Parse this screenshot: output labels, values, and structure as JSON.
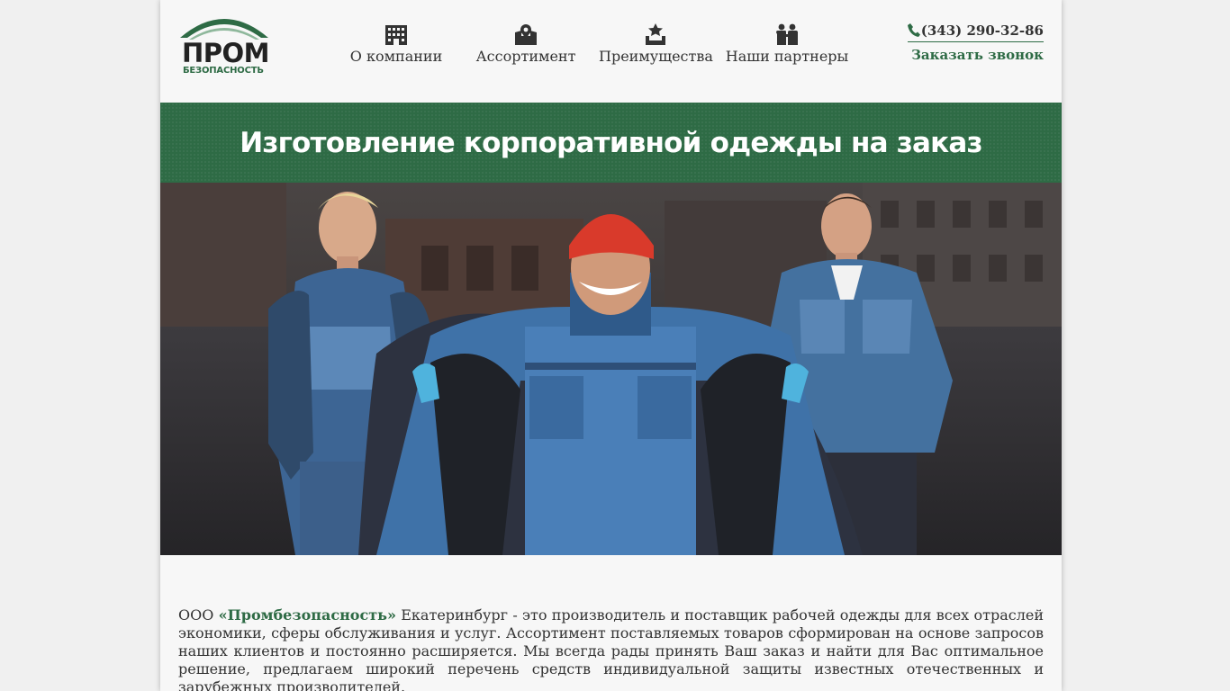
{
  "logo": {
    "word": "ПРОМ",
    "sub": "БЕЗОПАСНОСТЬ"
  },
  "nav": [
    {
      "label": "О компании",
      "icon": "building-icon"
    },
    {
      "label": "Ассортимент",
      "icon": "map-pin-icon"
    },
    {
      "label": "Преимущества",
      "icon": "award-icon"
    },
    {
      "label": "Наши партнеры",
      "icon": "partners-icon"
    }
  ],
  "contact": {
    "phone": "(343) 290-32-86",
    "callback": "Заказать звонок"
  },
  "banner": {
    "title": "Изготовление корпоративной одежды на заказ"
  },
  "intro": {
    "prefix": "ООО ",
    "company": "«Промбезопасность»",
    "text": " Екатеринбург - это производитель и поставщик рабочей одежды для всех отраслей экономики, сферы обслуживания и услуг. Ассортимент поставляемых товаров сформирован на основе запросов наших клиентов и постоянно расширяется. Мы всегда рады принять Ваш заказ и найти для Вас оптимальное решение, предлагаем широкий перечень средств индивидуальной защиты известных отечественных и зарубежных производителей."
  },
  "colors": {
    "brand_green": "#2e6b45",
    "text": "#333333",
    "hat_red": "#d93a2b",
    "jacket_blue": "#3f72a8"
  }
}
